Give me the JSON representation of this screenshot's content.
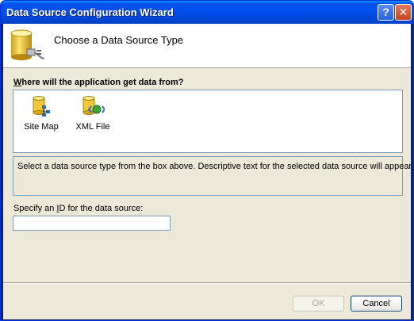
{
  "window": {
    "title": "Data Source Configuration Wizard"
  },
  "titlebar": {
    "help_glyph": "?",
    "close_glyph": "✕"
  },
  "header": {
    "icon": "database-plug-icon",
    "title": "Choose a Data Source Type"
  },
  "question": {
    "accel": "W",
    "rest": "here will the application get data from?"
  },
  "sources": [
    {
      "label": "Site Map",
      "icon": "site-map-icon"
    },
    {
      "label": "XML File",
      "icon": "xml-file-icon"
    }
  ],
  "description": "Select a data source type from the box above. Descriptive text for the selected data source will appear here.",
  "id_field": {
    "label_before": "Specify an ",
    "accel": "I",
    "label_after": "D for the data source:",
    "value": ""
  },
  "buttons": {
    "ok": "OK",
    "cancel": "Cancel"
  },
  "colors": {
    "title_blue": "#0053ee",
    "client_bg": "#ece9d8",
    "border_blue": "#7f9db9"
  }
}
